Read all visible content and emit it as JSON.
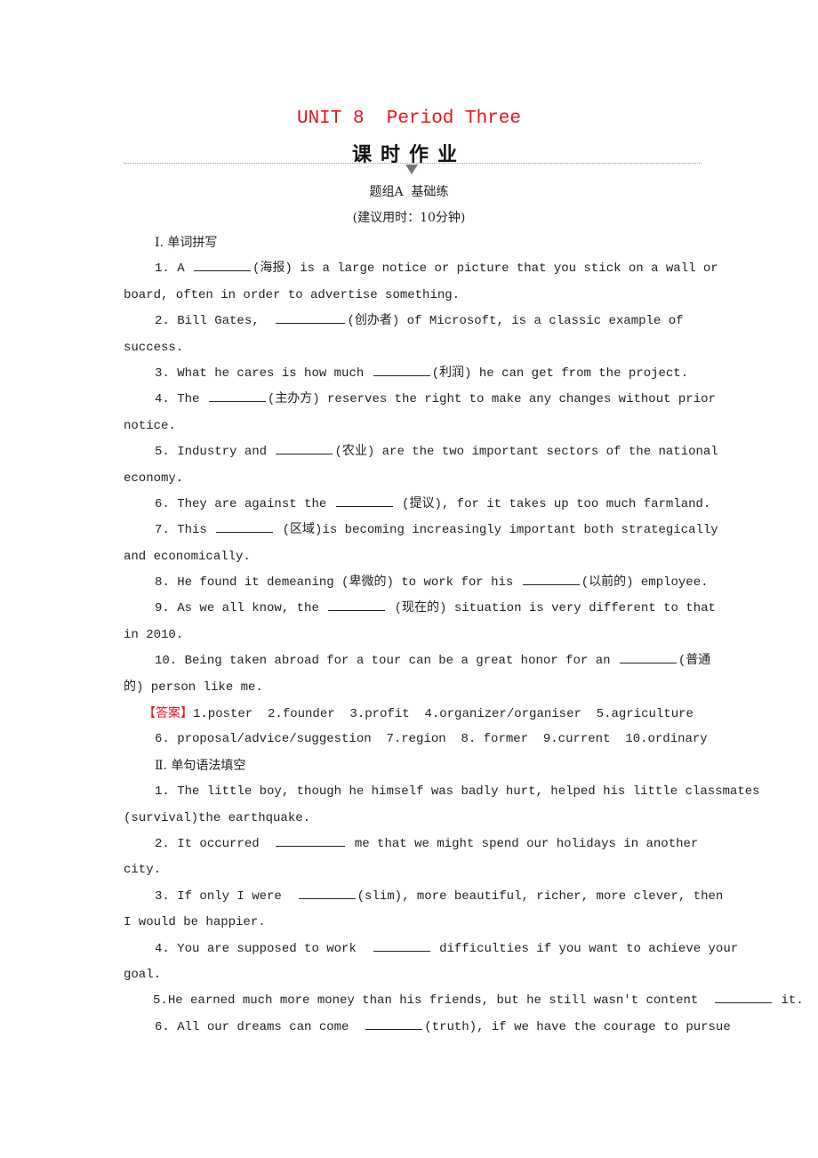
{
  "header": {
    "unit_title": "UNIT 8  Period Three",
    "homework_title": "课时作业",
    "group_title": "题组A  基础练",
    "time_hint": "(建议用时：10分钟)"
  },
  "section1": {
    "heading": "Ⅰ. 单词拼写",
    "items": [
      {
        "num": "1.",
        "parts": [
          "A ",
          "(海报) is a large notice or picture that you stick on a wall or"
        ],
        "cont": "board, often in order to advertise something."
      },
      {
        "num": "2.",
        "parts": [
          "Bill Gates, ",
          "(创办者) of Microsoft, is a classic example of"
        ],
        "cont": "success."
      },
      {
        "num": "3.",
        "parts": [
          "What he cares is how much ",
          "(利润) he can get from the project."
        ],
        "cont": ""
      },
      {
        "num": "4.",
        "parts": [
          "The ",
          "(主办方) reserves the right to make any changes without prior"
        ],
        "cont": "notice."
      },
      {
        "num": "5.",
        "parts": [
          "Industry and ",
          "(农业) are the two important sectors of the national"
        ],
        "cont": "economy."
      },
      {
        "num": "6.",
        "parts": [
          "They are against the ",
          " (提议), for it takes up too much farmland."
        ],
        "cont": ""
      },
      {
        "num": "7.",
        "parts": [
          "This ",
          " (区域)is becoming increasingly important both strategically"
        ],
        "cont": "and economically."
      },
      {
        "num": "8.",
        "parts": [
          "He found it demeaning (卑微的) to work for his ",
          "(以前的) employee."
        ],
        "cont": ""
      },
      {
        "num": "9.",
        "parts": [
          "As we all know, the ",
          " (现在的) situation is very different to that"
        ],
        "cont": "in 2010."
      },
      {
        "num": "10.",
        "parts": [
          "Being taken abroad for a tour can be a great honor for an ",
          "(普通"
        ],
        "cont": "的) person like me."
      }
    ],
    "answer_tag": "【答案】",
    "answer_line1": "1.poster  2.founder  3.profit  4.organizer/organiser  5.agriculture",
    "answer_line2": "6. proposal/advice/suggestion  7.region  8. former  9.current  10.ordinary"
  },
  "section2": {
    "heading": "Ⅱ. 单句语法填空",
    "items": [
      {
        "num": "1.",
        "line1": "The little boy, though he himself was badly hurt, helped his little classmates",
        "cont": "(survival)the earthquake."
      },
      {
        "num": "2.",
        "parts": [
          "It occurred ",
          " me that we might spend our holidays in another"
        ],
        "cont": "city."
      },
      {
        "num": "3.",
        "parts": [
          "If only I were ",
          "(slim), more beautiful, richer, more clever, then"
        ],
        "cont": "I would be happier."
      },
      {
        "num": "4.",
        "parts": [
          "You are supposed to work ",
          " difficulties if you want to achieve your"
        ],
        "cont": "goal."
      },
      {
        "num": "5.",
        "parts": [
          "He earned much more money than his friends, but he still wasn't content ",
          " it."
        ],
        "cont": ""
      },
      {
        "num": "6.",
        "parts": [
          "All our dreams can come ",
          "(truth), if we have the courage to pursue"
        ],
        "cont": ""
      }
    ]
  }
}
